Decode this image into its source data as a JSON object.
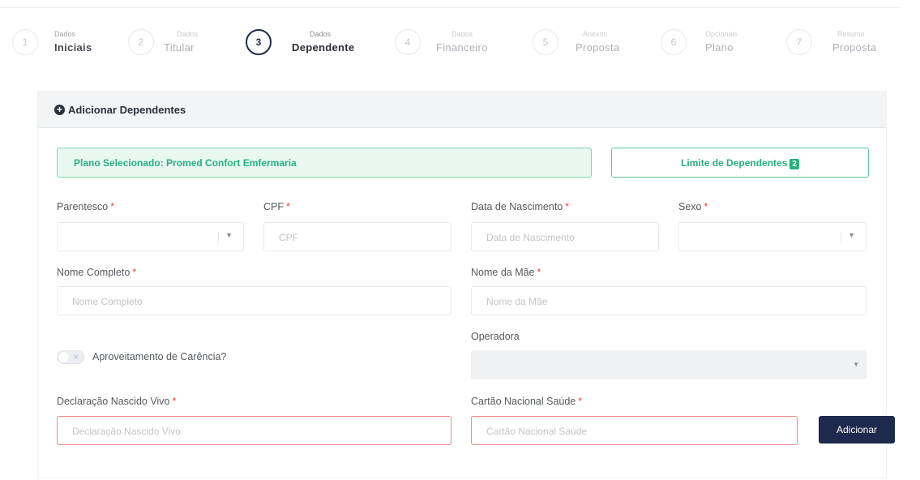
{
  "steps": [
    {
      "num": "1",
      "caption": "Dados",
      "label": "Iniciais",
      "state": "done"
    },
    {
      "num": "2",
      "caption": "Dados",
      "label": "Titular",
      "state": "pending"
    },
    {
      "num": "3",
      "caption": "Dados",
      "label": "Dependente",
      "state": "active"
    },
    {
      "num": "4",
      "caption": "Dados",
      "label": "Financeiro",
      "state": "pending"
    },
    {
      "num": "5",
      "caption": "Anexos",
      "label": "Proposta",
      "state": "pending"
    },
    {
      "num": "6",
      "caption": "Opcionais",
      "label": "Plano",
      "state": "pending"
    },
    {
      "num": "7",
      "caption": "Resumo",
      "label": "Proposta",
      "state": "pending"
    }
  ],
  "card": {
    "title": "Adicionar Dependentes",
    "plan_text": "Plano Selecionado: Promed Confort Emfermaria",
    "limit_text": "Limite de Dependentes",
    "limit_count": "2"
  },
  "form": {
    "parentesco": {
      "label": "Parentesco",
      "required": "*",
      "value": ""
    },
    "cpf": {
      "label": "CPF",
      "required": "*",
      "placeholder": "CPF"
    },
    "data_nascimento": {
      "label": "Data de Nascimento",
      "required": "*",
      "placeholder": "Data de Nascimento"
    },
    "sexo": {
      "label": "Sexo",
      "required": "*",
      "value": ""
    },
    "nome_completo": {
      "label": "Nome Completo",
      "required": "*",
      "placeholder": "Nome Completo"
    },
    "nome_mae": {
      "label": "Nome da Mãe",
      "required": "*",
      "placeholder": "Nome da Mãe"
    },
    "operadora": {
      "label": "Operadora",
      "value": ""
    },
    "carencia": {
      "label": "Aproveitamento de Carência?",
      "checked": false
    },
    "declaracao": {
      "label": "Declaração Nascido Vivo",
      "required": "*",
      "placeholder": "Declaração Nascido Vivo"
    },
    "cartao": {
      "label": "Cartão Nacional Saúde",
      "required": "*",
      "placeholder": "Cartão Nacional Saúde"
    }
  },
  "actions": {
    "add_label": "Adicionar"
  },
  "colors": {
    "primary": "#1e2a4d",
    "success": "#27b17a",
    "required": "#f0433a",
    "error_border": "#ea8a89"
  }
}
